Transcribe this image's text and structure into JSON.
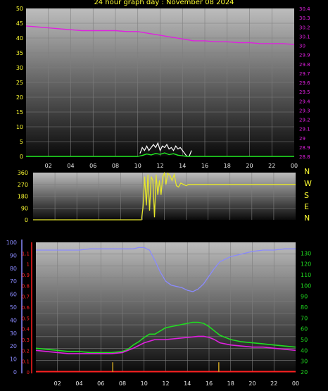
{
  "title": "24 hour graph day : November 08 2024",
  "compass": [
    "N",
    "W",
    "S",
    "E",
    "N"
  ],
  "colors": {
    "background": "#000000",
    "plot_top": "#bdbdbd",
    "plot_bottom": "#0a0a0a",
    "grid": "#7f7f7f",
    "axis_text_left": "#ffff33",
    "pressure": "#e020e0",
    "wind_gust": "#ffffff",
    "wind_avg": "#22ee22",
    "wind_direction": "#e6e62a",
    "humidity": "#8a8aff",
    "temperature": "#20dd20",
    "dewpoint": "#e020e0",
    "rain": "#ff2020",
    "uv_ticks": "#c8a020",
    "solar_axis": "#ff2020"
  },
  "chart_data": [
    {
      "type": "line",
      "name": "wind-and-pressure",
      "x_ticks": [
        "02",
        "04",
        "06",
        "08",
        "10",
        "12",
        "14",
        "16",
        "18",
        "20",
        "22",
        "00"
      ],
      "ylim_left": [
        0,
        50
      ],
      "yticks_left": [
        0,
        5,
        10,
        15,
        20,
        25,
        30,
        35,
        40,
        45,
        50
      ],
      "ylim_right": [
        28.8,
        30.4
      ],
      "yticks_right": [
        "28.8",
        "28.9",
        "29",
        "29.1",
        "29.2",
        "29.3",
        "29.4",
        "29.5",
        "29.6",
        "29.7",
        "29.8",
        "29.9",
        "30",
        "30.1",
        "30.2",
        "30.3",
        "30.4"
      ],
      "series": [
        {
          "key": "pressure",
          "axis": "right",
          "x": [
            0,
            1,
            2,
            3,
            4,
            5,
            6,
            7,
            8,
            9,
            10,
            11,
            12,
            13,
            14,
            15,
            16,
            17,
            18,
            19,
            20,
            21,
            22,
            23,
            24
          ],
          "y": [
            30.21,
            30.2,
            30.19,
            30.18,
            30.17,
            30.16,
            30.16,
            30.16,
            30.16,
            30.15,
            30.15,
            30.13,
            30.11,
            30.09,
            30.07,
            30.05,
            30.05,
            30.04,
            30.04,
            30.03,
            30.03,
            30.02,
            30.02,
            30.02,
            30.01
          ]
        },
        {
          "key": "wind_gust",
          "axis": "left",
          "x": [
            10.2,
            10.4,
            10.6,
            10.8,
            11,
            11.2,
            11.4,
            11.6,
            11.8,
            12,
            12.2,
            12.4,
            12.6,
            12.8,
            13,
            13.2,
            13.4,
            13.6,
            13.8,
            14,
            14.2,
            14.4,
            14.6,
            14.8
          ],
          "y": [
            1,
            3,
            2,
            3.5,
            2,
            3,
            4,
            3,
            4.5,
            2,
            3.5,
            3,
            4,
            2.5,
            3,
            2,
            3.5,
            2.5,
            3,
            2,
            1,
            0,
            0,
            2
          ]
        },
        {
          "key": "wind_avg",
          "axis": "left",
          "x": [
            0,
            10,
            10.4,
            10.8,
            11.2,
            11.6,
            12,
            12.4,
            12.8,
            13.2,
            13.6,
            14,
            14.4,
            24
          ],
          "y": [
            0,
            0,
            0.3,
            0.8,
            0.5,
            1,
            0.7,
            1.2,
            0.6,
            0.9,
            0.4,
            0.2,
            0,
            0
          ]
        }
      ]
    },
    {
      "type": "line",
      "name": "wind-direction",
      "ylim": [
        0,
        360
      ],
      "yticks": [
        0,
        90,
        180,
        270,
        360
      ],
      "series": [
        {
          "key": "wind_direction",
          "x": [
            0,
            8.1,
            9.9,
            10.05,
            10.2,
            10.35,
            10.5,
            10.65,
            10.8,
            10.95,
            11.1,
            11.25,
            11.4,
            11.55,
            11.7,
            11.85,
            12,
            12.15,
            12.3,
            12.5,
            12.7,
            12.9,
            13.1,
            13.3,
            13.5,
            14,
            14.2,
            24
          ],
          "y": [
            0,
            0,
            0,
            95,
            330,
            110,
            345,
            70,
            330,
            300,
            20,
            345,
            190,
            300,
            190,
            330,
            355,
            270,
            355,
            340,
            300,
            345,
            260,
            250,
            280,
            260,
            270,
            270
          ]
        }
      ]
    },
    {
      "type": "line",
      "name": "humidity-temperature-solar",
      "ylim_humidity": [
        0,
        100
      ],
      "yticks_humidity": [
        0,
        10,
        20,
        30,
        40,
        50,
        60,
        70,
        80,
        90,
        100
      ],
      "ylim_solar": [
        0,
        1.2
      ],
      "yticks_solar": [
        "0",
        "0.1",
        "0.2",
        "0.3",
        "0.4",
        "0.5",
        "0.6",
        "0.7",
        "0.8",
        "0.9",
        "1",
        "1.1"
      ],
      "ylim_temp": [
        20,
        140
      ],
      "yticks_temp": [
        20,
        30,
        40,
        50,
        60,
        70,
        80,
        90,
        100,
        110,
        120,
        130
      ],
      "series": [
        {
          "key": "humidity",
          "axis": "humidity",
          "x": [
            0,
            1,
            2,
            3,
            4,
            5,
            6,
            7,
            8,
            9,
            9.5,
            10,
            10.5,
            11,
            11.5,
            12,
            12.5,
            13,
            13.5,
            14,
            14.5,
            15,
            15.5,
            16,
            16.5,
            17,
            18,
            19,
            20,
            21,
            22,
            23,
            24
          ],
          "y": [
            94,
            94,
            94,
            94,
            94,
            95,
            95,
            95,
            95,
            95,
            96,
            96,
            94,
            86,
            77,
            70,
            67,
            66,
            65,
            63,
            62,
            64,
            68,
            74,
            80,
            85,
            89,
            91,
            93,
            94,
            94,
            95,
            95
          ]
        },
        {
          "key": "temperature",
          "axis": "temp",
          "x": [
            0,
            1,
            2,
            3,
            4,
            5,
            6,
            7,
            8,
            8.5,
            9,
            9.5,
            10,
            10.5,
            11,
            11.5,
            12,
            12.5,
            13,
            13.5,
            14,
            14.5,
            15,
            15.5,
            16,
            16.5,
            17,
            18,
            19,
            20,
            21,
            22,
            23,
            24
          ],
          "y": [
            42,
            41,
            40,
            39,
            39,
            38,
            38,
            38,
            39,
            41,
            45,
            48,
            52,
            55,
            55,
            58,
            61,
            62,
            63,
            64,
            65,
            66,
            66,
            65,
            62,
            58,
            54,
            50,
            48,
            47,
            46,
            45,
            44,
            43
          ]
        },
        {
          "key": "dewpoint",
          "axis": "temp",
          "x": [
            0,
            1,
            2,
            3,
            4,
            5,
            6,
            7,
            8,
            9,
            10,
            11,
            12,
            13,
            14,
            15,
            15.5,
            16,
            16.5,
            17,
            18,
            19,
            20,
            21,
            22,
            23,
            24
          ],
          "y": [
            40,
            39,
            38,
            37,
            37,
            37,
            37,
            37,
            38,
            42,
            47,
            50,
            50,
            51,
            52,
            53,
            53,
            52,
            50,
            47,
            45,
            44,
            43,
            43,
            42,
            41,
            40
          ]
        },
        {
          "key": "uv",
          "axis": "solar",
          "x": [
            7.1,
            16.9
          ],
          "y": [
            0.09,
            0.09
          ]
        }
      ]
    }
  ]
}
